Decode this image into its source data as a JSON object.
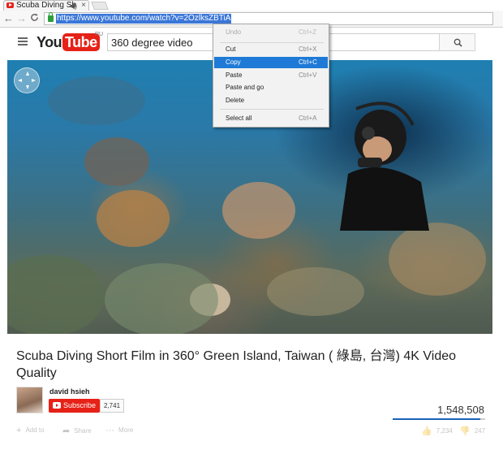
{
  "browser": {
    "tab_title": "Scuba Diving Shor",
    "tab_speaker": "◀)",
    "tab_close": "×",
    "back": "←",
    "forward": "→",
    "reload": "C",
    "url": "https://www.youtube.com/watch?v=2OzlksZBTiA"
  },
  "youtube": {
    "logo_you": "You",
    "logo_tube": "Tube",
    "logo_region": "RU",
    "search_value": "360 degree video"
  },
  "context_menu": {
    "items": [
      {
        "label": "Undo",
        "shortcut": "Ctrl+Z",
        "state": "disabled"
      },
      {
        "label": "Cut",
        "shortcut": "Ctrl+X",
        "state": "normal"
      },
      {
        "label": "Copy",
        "shortcut": "Ctrl+C",
        "state": "highlighted"
      },
      {
        "label": "Paste",
        "shortcut": "Ctrl+V",
        "state": "normal"
      },
      {
        "label": "Paste and go",
        "shortcut": "",
        "state": "normal"
      },
      {
        "label": "Delete",
        "shortcut": "",
        "state": "normal"
      },
      {
        "label": "Select all",
        "shortcut": "Ctrl+A",
        "state": "normal"
      }
    ]
  },
  "video": {
    "title": "Scuba Diving Short Film in 360° Green Island, Taiwan ( 綠島, 台灣) 4K Video Quality",
    "channel": "david hsieh",
    "subscribe_label": "Subscribe",
    "subscriber_count": "2,741",
    "views": "1,548,508",
    "like_ratio": 0.95
  },
  "actions": {
    "add_to": "Add to",
    "share": "Share",
    "more": "More",
    "likes": "7,234",
    "dislikes": "247"
  },
  "colors": {
    "brand_red": "#e62117",
    "selection_blue": "#1e7ad6",
    "url_highlight": "#3b77d8"
  }
}
